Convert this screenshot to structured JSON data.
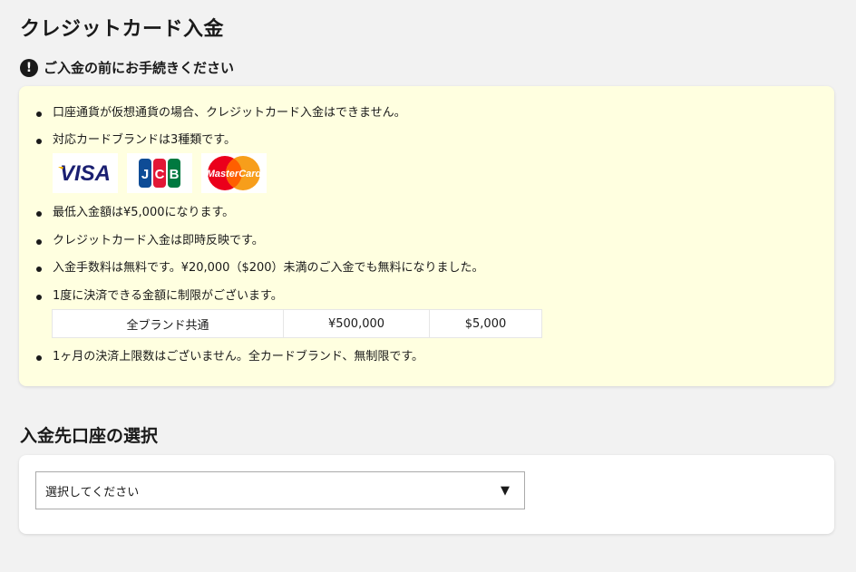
{
  "page": {
    "title": "クレジットカード入金"
  },
  "notice": {
    "icon": "exclamation-circle-icon",
    "icon_glyph": "!",
    "heading": "ご入金の前にお手続きください",
    "background": "#ffffe0",
    "items": [
      "口座通貨が仮想通貨の場合、クレジットカード入金はできません。",
      "対応カードブランドは3種類です。",
      "最低入金額は¥5,000になります。",
      "クレジットカード入金は即時反映です。",
      "入金手数料は無料です。¥20,000（$200）未満のご入金でも無料になりました。",
      "1度に決済できる金額に制限がございます。",
      "1ヶ月の決済上限数はございません。全カードブランド、無制限です。"
    ],
    "brands": [
      {
        "name": "VISA",
        "icon": "visa-logo"
      },
      {
        "name": "JCB",
        "icon": "jcb-logo"
      },
      {
        "name": "MasterCard",
        "icon": "mastercard-logo"
      }
    ],
    "limit_table": {
      "cells": [
        "全ブランド共通",
        "¥500,000",
        "$5,000"
      ]
    }
  },
  "deposit_account": {
    "title": "入金先口座の選択",
    "select": {
      "selected": "選択してください",
      "icon": "triangle-down-icon",
      "arrow_glyph": "▼"
    }
  },
  "colors": {
    "background": "#f2f2f2",
    "visa_blue": "#1a1f71",
    "visa_gold": "#f7b600",
    "mc_red": "#eb001b",
    "mc_orange": "#f79e1b"
  }
}
